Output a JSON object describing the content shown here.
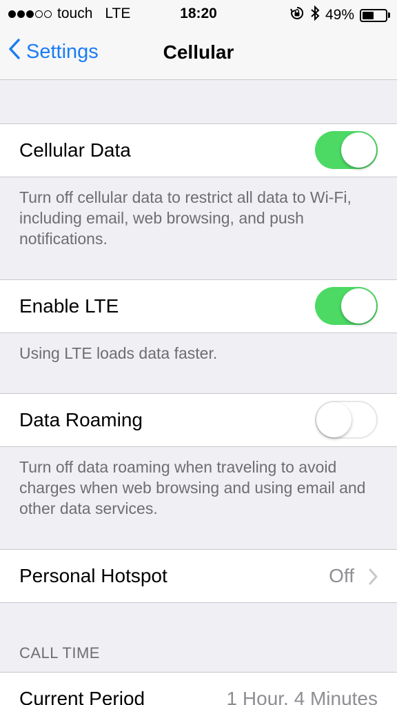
{
  "status": {
    "carrier": "touch",
    "network": "LTE",
    "time": "18:20",
    "battery_percent": "49%",
    "battery_level": 0.49,
    "signal_bars_filled": 3,
    "signal_bars_total": 5,
    "icons": [
      "rotation-lock-icon",
      "bluetooth-icon",
      "battery-icon"
    ]
  },
  "nav": {
    "back_label": "Settings",
    "title": "Cellular"
  },
  "cells": {
    "cellular_data": {
      "label": "Cellular Data",
      "state": "on"
    },
    "cellular_data_footer": "Turn off cellular data to restrict all data to Wi-Fi, including email, web browsing, and push notifications.",
    "enable_lte": {
      "label": "Enable LTE",
      "state": "on"
    },
    "enable_lte_footer": "Using LTE loads data faster.",
    "data_roaming": {
      "label": "Data Roaming",
      "state": "off"
    },
    "data_roaming_footer": "Turn off data roaming when traveling to avoid charges when web browsing and using email and other data services.",
    "personal_hotspot": {
      "label": "Personal Hotspot",
      "value": "Off"
    }
  },
  "call_time": {
    "header": "CALL TIME",
    "current_period": {
      "label": "Current Period",
      "value": "1 Hour, 4 Minutes"
    }
  },
  "colors": {
    "accent": "#1a7cf5",
    "toggle_on": "#4cd964",
    "background": "#efeff4",
    "secondary_text": "#6d6d72"
  }
}
